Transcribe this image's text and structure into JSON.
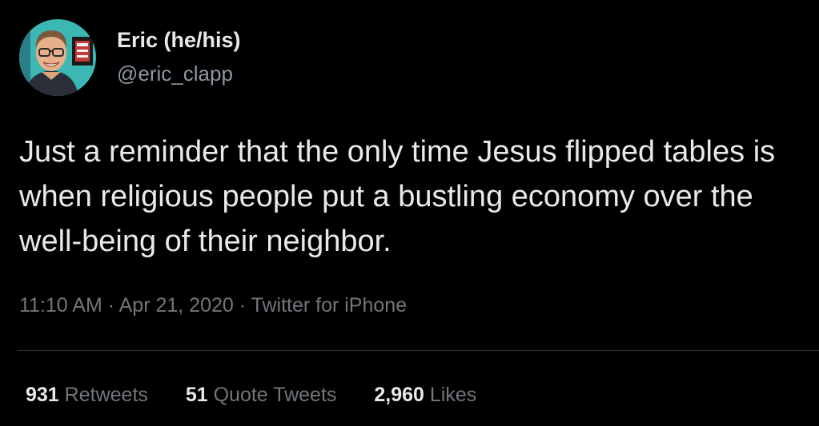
{
  "author": {
    "display_name": "Eric (he/his)",
    "handle": "@eric_clapp",
    "avatar_icon": "profile-photo"
  },
  "tweet": {
    "text": "Just a reminder that the only time Jesus flipped tables is when religious people put a bustling economy over the well-being of their neighbor."
  },
  "meta": {
    "time": "11:10 AM",
    "separator": " · ",
    "date": "Apr 21, 2020",
    "source": "Twitter for iPhone"
  },
  "stats": {
    "retweets": {
      "count": "931",
      "label": "Retweets"
    },
    "quotes": {
      "count": "51",
      "label": "Quote Tweets"
    },
    "likes": {
      "count": "2,960",
      "label": "Likes"
    }
  },
  "colors": {
    "background": "#000000",
    "primary_text": "#e7e9ea",
    "secondary_text": "#71767b",
    "divider": "#2f3336"
  }
}
